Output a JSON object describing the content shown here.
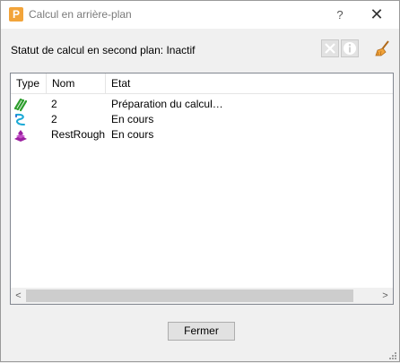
{
  "window": {
    "title": "Calcul en arrière-plan",
    "app_icon_letter": "P",
    "help_label": "?",
    "close_label": "✕"
  },
  "status": {
    "label": "Statut de calcul en second plan: Inactif"
  },
  "toolbar": {
    "cancel_icon": "cancel-icon",
    "info_icon": "info-icon",
    "clear_icon": "broom-icon"
  },
  "list": {
    "columns": [
      "Type",
      "Nom",
      "Etat"
    ],
    "rows": [
      {
        "icon": "toolpath-zigzag-icon",
        "nom": "2",
        "etat": "Préparation du calcul…"
      },
      {
        "icon": "toolpath-curve-icon",
        "nom": "2",
        "etat": "En cours"
      },
      {
        "icon": "rest-roughing-icon",
        "nom": "RestRough",
        "etat": "En cours"
      }
    ],
    "scroll_left": "<",
    "scroll_right": ">"
  },
  "buttons": {
    "close_label": "Fermer"
  },
  "colors": {
    "accent_orange": "#f2a43a",
    "icon_green": "#2e9e2e",
    "icon_cyan": "#1aa9d6",
    "icon_magenta": "#9b1fa0"
  }
}
